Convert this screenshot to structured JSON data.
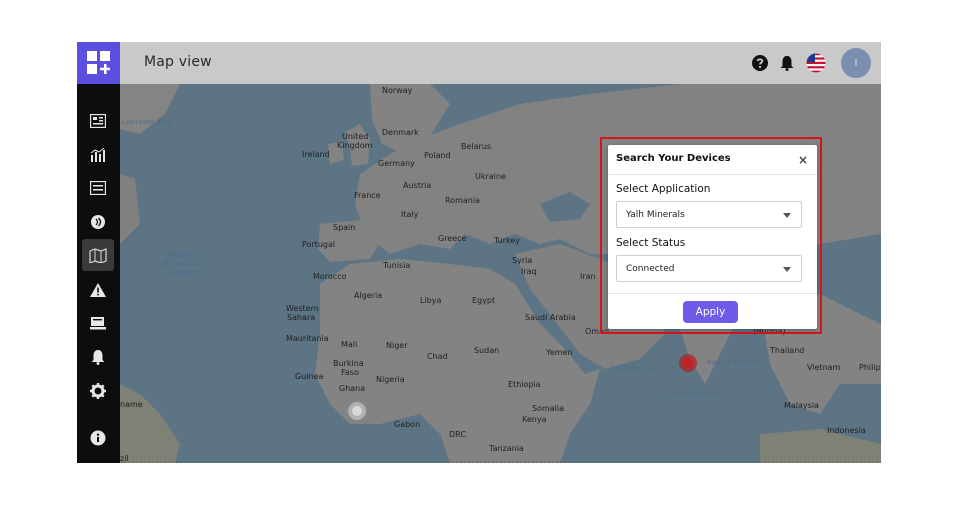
{
  "header": {
    "title": "Map view",
    "avatar_initial": "I"
  },
  "icons": {
    "logo": "grid-plus-icon",
    "help": "question-circle-icon",
    "notifications": "bell-icon",
    "language": "us-flag-icon"
  },
  "sidebar": {
    "items": [
      {
        "icon": "dashboard-icon"
      },
      {
        "icon": "analytics-icon"
      },
      {
        "icon": "list-icon"
      },
      {
        "icon": "broadcast-icon"
      },
      {
        "icon": "map-icon",
        "active": true
      },
      {
        "icon": "alert-icon"
      },
      {
        "icon": "device-icon"
      },
      {
        "icon": "bell-icon"
      },
      {
        "icon": "gear-icon"
      },
      {
        "icon": "info-icon"
      }
    ]
  },
  "map": {
    "labels": [
      {
        "text": "Norway"
      },
      {
        "text": "Labrador Sea"
      },
      {
        "text": "United"
      },
      {
        "text": "Kingdom"
      },
      {
        "text": "Denmark"
      },
      {
        "text": "Ireland"
      },
      {
        "text": "Belarus"
      },
      {
        "text": "Germany"
      },
      {
        "text": "Poland"
      },
      {
        "text": "Ukraine"
      },
      {
        "text": "France"
      },
      {
        "text": "Austria"
      },
      {
        "text": "Romania"
      },
      {
        "text": "Italy"
      },
      {
        "text": "Spain"
      },
      {
        "text": "Portugal"
      },
      {
        "text": "Greece"
      },
      {
        "text": "Turkey"
      },
      {
        "text": "North"
      },
      {
        "text": "Atlantic"
      },
      {
        "text": "Ocean"
      },
      {
        "text": "Syria"
      },
      {
        "text": "Iraq"
      },
      {
        "text": "Iran"
      },
      {
        "text": "Tunisia"
      },
      {
        "text": "Morocco"
      },
      {
        "text": "Algeria"
      },
      {
        "text": "Libya"
      },
      {
        "text": "Egypt"
      },
      {
        "text": "Saudi Arabia"
      },
      {
        "text": "Oman"
      },
      {
        "text": "Western"
      },
      {
        "text": "Sahara"
      },
      {
        "text": "Mauritania"
      },
      {
        "text": "Mali"
      },
      {
        "text": "Niger"
      },
      {
        "text": "Chad"
      },
      {
        "text": "Sudan"
      },
      {
        "text": "Yemen"
      },
      {
        "text": "Burkina"
      },
      {
        "text": "Faso"
      },
      {
        "text": "Guinea"
      },
      {
        "text": "Nigeria"
      },
      {
        "text": "Ghana"
      },
      {
        "text": "Ethiopia"
      },
      {
        "text": "Somalia"
      },
      {
        "text": "Arabian Sea"
      },
      {
        "text": "Bay of Bengal"
      },
      {
        "text": "Laccadive Sea"
      },
      {
        "text": "(Burma)"
      },
      {
        "text": "Thailand"
      },
      {
        "text": "Vietnam"
      },
      {
        "text": "Philip"
      },
      {
        "text": "Malaysia"
      },
      {
        "text": "Indonesia"
      },
      {
        "text": "Kenya"
      },
      {
        "text": "Gabon"
      },
      {
        "text": "DRC"
      },
      {
        "text": "Tanzania"
      },
      {
        "text": "name"
      },
      {
        "text": "zil"
      }
    ]
  },
  "popup": {
    "title": "Search Your Devices",
    "close_label": "×",
    "application_label": "Select Application",
    "application_value": "Yalh Minerals",
    "status_label": "Select Status",
    "status_value": "Connected",
    "apply_label": "Apply"
  },
  "colors": {
    "accent": "#6c5ce7",
    "logo_bg": "#5b4fe0",
    "highlight": "#d6141b",
    "sidebar_bg": "#0d0d0d"
  }
}
